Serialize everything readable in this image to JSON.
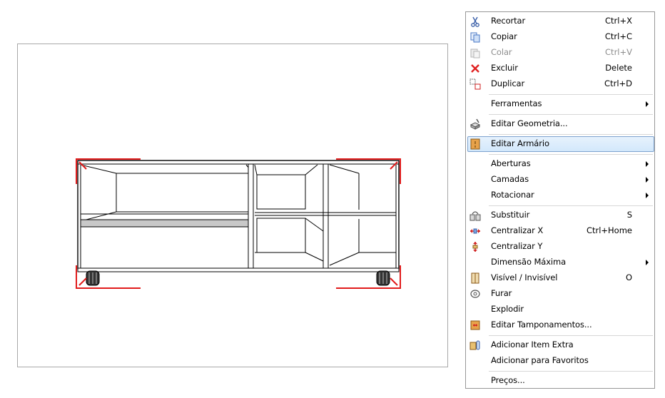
{
  "menu": {
    "items": [
      {
        "label": "Recortar",
        "shortcut": "Ctrl+X",
        "icon": "scissors-icon",
        "disabled": false
      },
      {
        "label": "Copiar",
        "shortcut": "Ctrl+C",
        "icon": "copy-icon",
        "disabled": false
      },
      {
        "label": "Colar",
        "shortcut": "Ctrl+V",
        "icon": "paste-icon",
        "disabled": true
      },
      {
        "label": "Excluir",
        "shortcut": "Delete",
        "icon": "delete-x-icon",
        "disabled": false
      },
      {
        "label": "Duplicar",
        "shortcut": "Ctrl+D",
        "icon": "duplicate-icon",
        "disabled": false
      },
      {
        "label": "Ferramentas",
        "submenu": true
      },
      {
        "label": "Editar Geometria...",
        "icon": "edit-geometry-icon"
      },
      {
        "label": "Editar Armário",
        "icon": "edit-cabinet-icon",
        "highlighted": true
      },
      {
        "label": "Aberturas",
        "submenu": true
      },
      {
        "label": "Camadas",
        "submenu": true
      },
      {
        "label": "Rotacionar",
        "submenu": true
      },
      {
        "label": "Substituir",
        "shortcut": "S",
        "icon": "replace-icon"
      },
      {
        "label": "Centralizar X",
        "shortcut": "Ctrl+Home",
        "icon": "center-x-icon"
      },
      {
        "label": "Centralizar Y",
        "icon": "center-y-icon"
      },
      {
        "label": "Dimensão Máxima",
        "submenu": true
      },
      {
        "label": "Visível / Invisível",
        "shortcut": "O",
        "icon": "visibility-icon"
      },
      {
        "label": "Furar",
        "icon": "drill-icon"
      },
      {
        "label": "Explodir"
      },
      {
        "label": "Editar Tamponamentos...",
        "icon": "edit-covers-icon"
      },
      {
        "label": "Adicionar Item Extra",
        "icon": "add-extra-item-icon"
      },
      {
        "label": "Adicionar para Favoritos"
      },
      {
        "label": "Preços..."
      }
    ]
  },
  "colors": {
    "highlight_border": "#7da2ce",
    "selection_red": "#e11b1b",
    "disabled_text": "#8d8d8d"
  }
}
